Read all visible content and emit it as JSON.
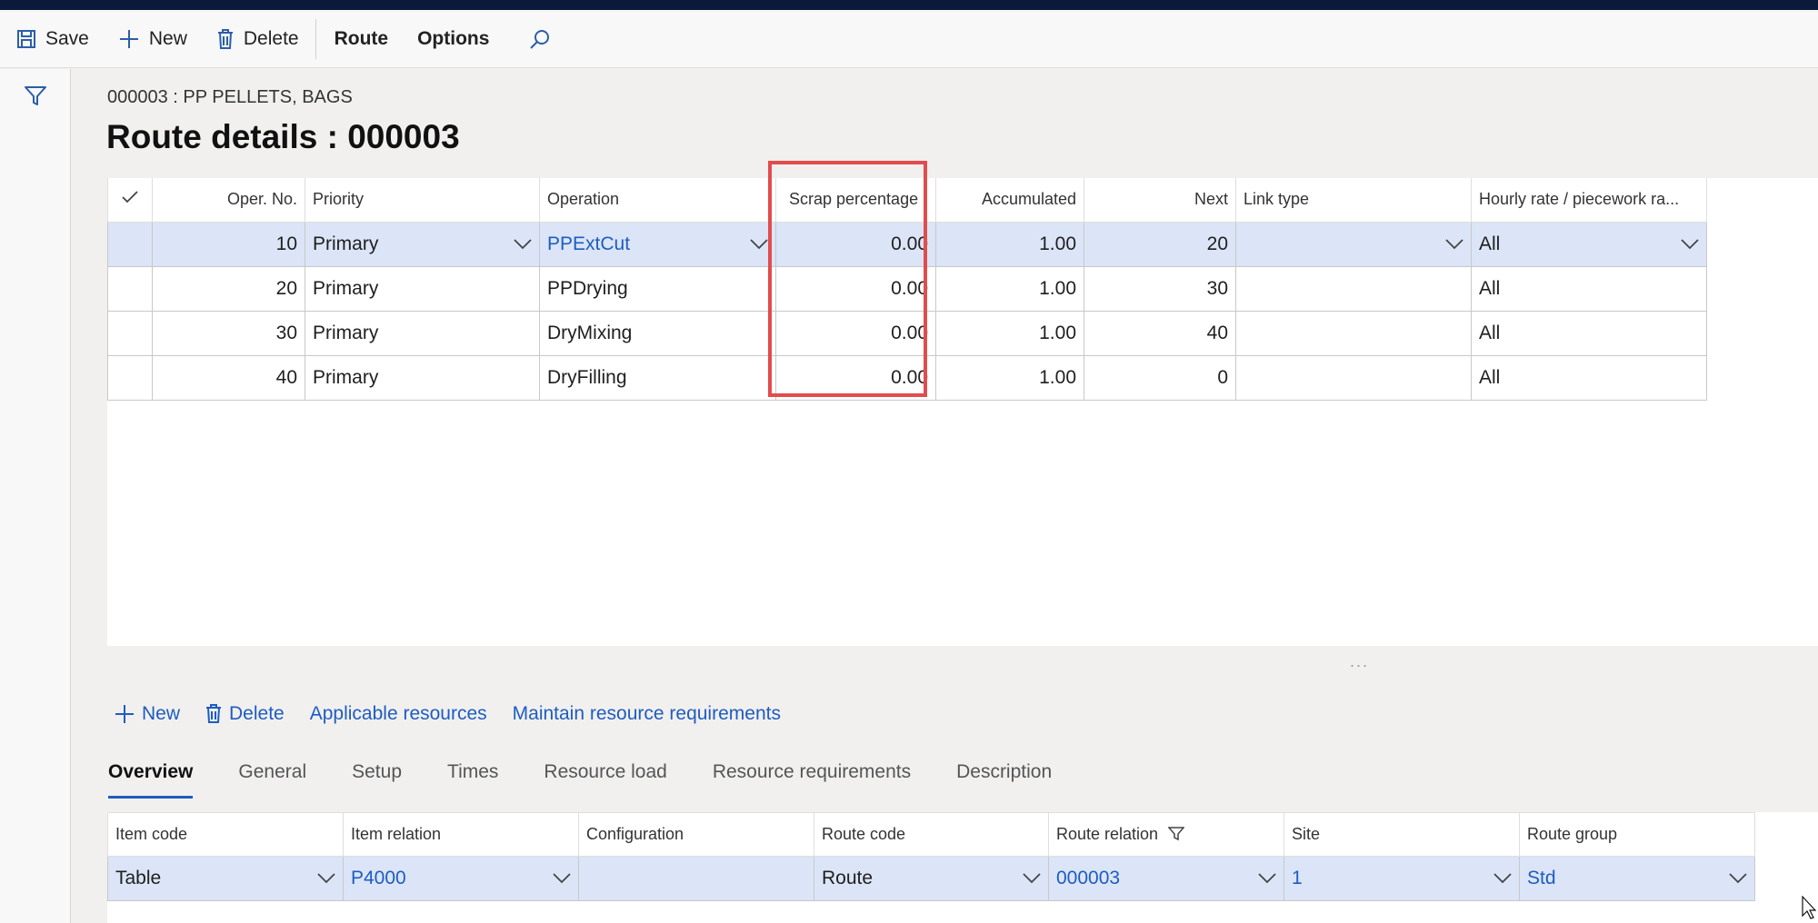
{
  "toolbar": {
    "save": "Save",
    "new": "New",
    "delete": "Delete",
    "route": "Route",
    "options": "Options"
  },
  "caption": "000003 : PP PELLETS, BAGS",
  "title": "Route details : 000003",
  "grid": {
    "headers": [
      "Oper. No.",
      "Priority",
      "Operation",
      "Scrap percentage",
      "Accumulated",
      "Next",
      "Link type",
      "Hourly rate / piecework ra..."
    ],
    "rows": [
      {
        "oper": "10",
        "priority": "Primary",
        "operation": "PPExtCut",
        "scrap": "0.00",
        "accum": "1.00",
        "next": "20",
        "link": "",
        "rate": "All"
      },
      {
        "oper": "20",
        "priority": "Primary",
        "operation": "PPDrying",
        "scrap": "0.00",
        "accum": "1.00",
        "next": "30",
        "link": "",
        "rate": "All"
      },
      {
        "oper": "30",
        "priority": "Primary",
        "operation": "DryMixing",
        "scrap": "0.00",
        "accum": "1.00",
        "next": "40",
        "link": "",
        "rate": "All"
      },
      {
        "oper": "40",
        "priority": "Primary",
        "operation": "DryFilling",
        "scrap": "0.00",
        "accum": "1.00",
        "next": "0",
        "link": "",
        "rate": "All"
      }
    ],
    "selected_row": 0,
    "splitter": "..."
  },
  "subbar": {
    "new": "New",
    "delete": "Delete",
    "applicable": "Applicable resources",
    "maintain": "Maintain resource requirements"
  },
  "tabs": [
    "Overview",
    "General",
    "Setup",
    "Times",
    "Resource load",
    "Resource requirements",
    "Description"
  ],
  "detail": {
    "headers": [
      "Item code",
      "Item relation",
      "Configuration",
      "Route code",
      "Route relation",
      "Site",
      "Route group"
    ],
    "values": [
      "Table",
      "P4000",
      "",
      "Route",
      "000003",
      "1",
      "Std"
    ]
  },
  "colors": {
    "accent": "#1e5cc0",
    "highlight": "#e24c4b",
    "selected": "#dbe5f7",
    "topbar": "#0b1a3a"
  }
}
